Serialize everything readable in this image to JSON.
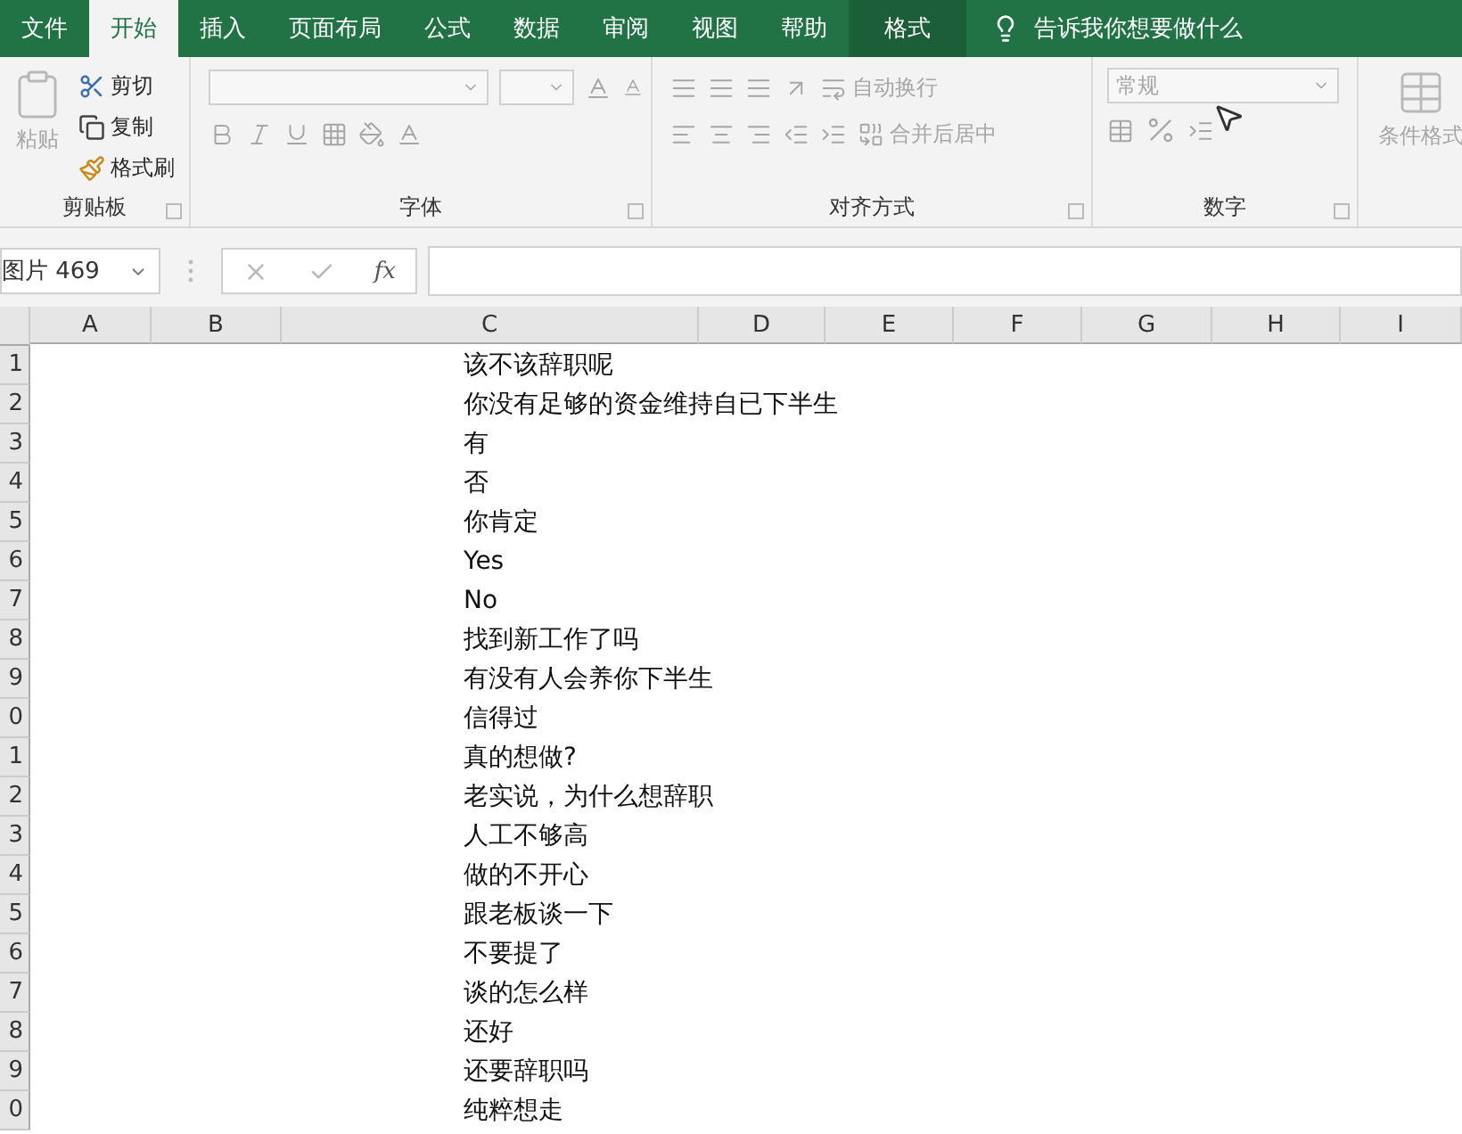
{
  "tabs": [
    {
      "label": "文件",
      "selected": false,
      "kind": "file"
    },
    {
      "label": "开始",
      "selected": true,
      "kind": "normal"
    },
    {
      "label": "插入",
      "selected": false,
      "kind": "normal"
    },
    {
      "label": "页面布局",
      "selected": false,
      "kind": "normal"
    },
    {
      "label": "公式",
      "selected": false,
      "kind": "normal"
    },
    {
      "label": "数据",
      "selected": false,
      "kind": "normal"
    },
    {
      "label": "审阅",
      "selected": false,
      "kind": "normal"
    },
    {
      "label": "视图",
      "selected": false,
      "kind": "normal"
    },
    {
      "label": "帮助",
      "selected": false,
      "kind": "normal"
    },
    {
      "label": "格式",
      "selected": false,
      "kind": "context"
    }
  ],
  "tell_me": "告诉我你想要做什么",
  "clipboard": {
    "title": "剪贴板",
    "paste": {
      "label": "粘贴",
      "disabled": true
    },
    "items": [
      {
        "label": "剪切",
        "kind": "cut",
        "disabled": false
      },
      {
        "label": "复制",
        "kind": "copy",
        "disabled": false
      },
      {
        "label": "格式刷",
        "kind": "painter",
        "disabled": false
      }
    ]
  },
  "font": {
    "title": "字体",
    "disabled": true
  },
  "alignment": {
    "title": "对齐方式",
    "wrap": "自动换行",
    "merge": "合并后居中",
    "disabled": true
  },
  "number": {
    "title": "数字",
    "format": "常规",
    "disabled": true
  },
  "styles": {
    "conditional": "条件格式",
    "disabled": true
  },
  "name_box": "图片 469",
  "fx": "fx",
  "columns": [
    "A",
    "B",
    "C",
    "D",
    "E",
    "F",
    "G",
    "H",
    "I"
  ],
  "rows": [
    {
      "number": "1",
      "c": "该不该辞职呢"
    },
    {
      "number": "2",
      "c": "你没有足够的资金维持自已下半生"
    },
    {
      "number": "3",
      "c": "有"
    },
    {
      "number": "4",
      "c": "否"
    },
    {
      "number": "5",
      "c": "你肯定"
    },
    {
      "number": "6",
      "c": "Yes"
    },
    {
      "number": "7",
      "c": "No"
    },
    {
      "number": "8",
      "c": "找到新工作了吗"
    },
    {
      "number": "9",
      "c": "有没有人会养你下半生"
    },
    {
      "number": "0",
      "c": "信得过"
    },
    {
      "number": "1",
      "c": "真的想做?"
    },
    {
      "number": "2",
      "c": "老实说，为什么想辞职"
    },
    {
      "number": "3",
      "c": "人工不够高"
    },
    {
      "number": "4",
      "c": "做的不开心"
    },
    {
      "number": "5",
      "c": "跟老板谈一下"
    },
    {
      "number": "6",
      "c": "不要提了"
    },
    {
      "number": "7",
      "c": "谈的怎么样"
    },
    {
      "number": "8",
      "c": "还好"
    },
    {
      "number": "9",
      "c": "还要辞职吗"
    },
    {
      "number": "0",
      "c": "纯粹想走"
    }
  ]
}
